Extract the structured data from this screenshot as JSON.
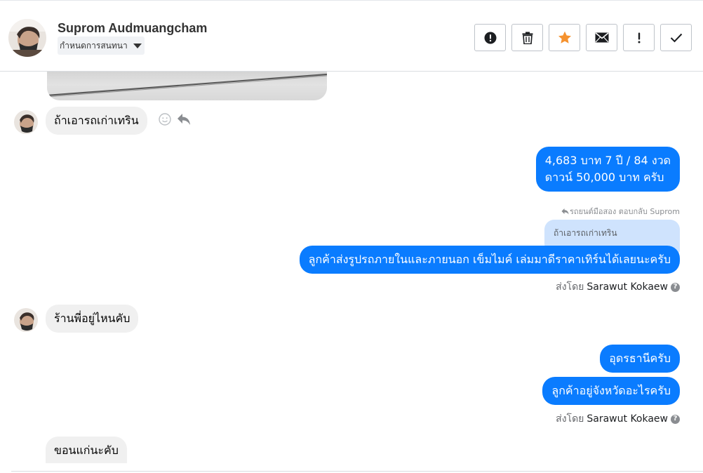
{
  "header": {
    "name": "Suprom Audmuangcham",
    "assign_label": "กำหนดการสนทนา",
    "toolbar": [
      {
        "icon": "alert-circle-icon"
      },
      {
        "icon": "trash-icon"
      },
      {
        "icon": "star-icon",
        "color": "#f5922f"
      },
      {
        "icon": "mail-icon"
      },
      {
        "icon": "exclamation-icon"
      },
      {
        "icon": "check-icon"
      }
    ]
  },
  "messages": [
    {
      "id": "m1",
      "side": "in",
      "text": "ถ้าเอารถเก่าเทริน"
    },
    {
      "id": "m2",
      "side": "out",
      "lines": [
        "4,683 บาท 7 ปี / 84 งวด",
        "ดาวน์ 50,000 บาท ครับ"
      ]
    },
    {
      "id": "m3",
      "side": "out",
      "reply_ref": "รถยนต์มือสอง ตอบกลับ Suprom",
      "quoted": "ถ้าเอารถเก่าเทริน",
      "text": "ลูกค้าส่งรูปรถภายในและภายนอก เข็มไมค์ เล่มมาดีราคาเทิร์นได้เลยนะครับ",
      "sent_by_label": "ส่งโดย",
      "sent_by_agent": "Sarawut Kokaew"
    },
    {
      "id": "m4",
      "side": "in",
      "text": "ร้านพี่อยู่ไหนคับ"
    },
    {
      "id": "m5",
      "side": "out",
      "text": "อุดรธานีครับ"
    },
    {
      "id": "m6",
      "side": "out",
      "text": "ลูกค้าอยู่จังหวัดอะไรครับ",
      "sent_by_label": "ส่งโดย",
      "sent_by_agent": "Sarawut Kokaew"
    },
    {
      "id": "m7",
      "side": "in",
      "text": "ขอนแก่นะคับ"
    }
  ],
  "colors": {
    "outgoing_bubble": "#0a7cff",
    "incoming_bubble": "#f0f0f0",
    "quoted_bubble": "#cfe3fd"
  }
}
